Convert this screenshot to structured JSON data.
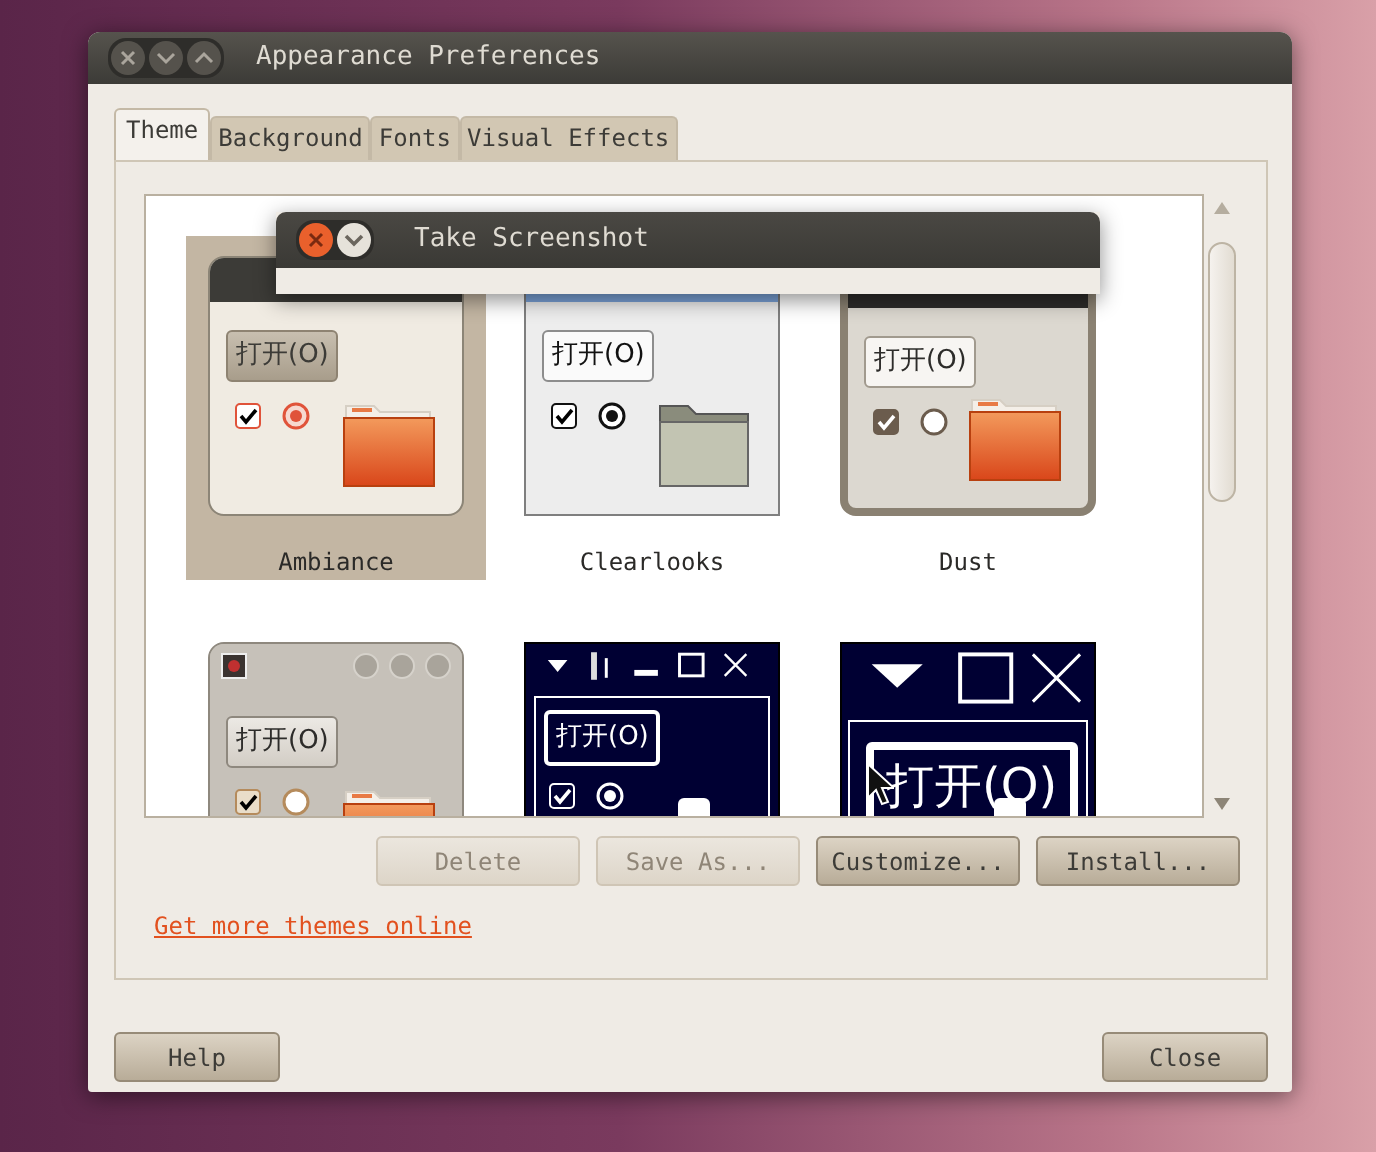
{
  "window": {
    "title": "Appearance Preferences"
  },
  "tabs": [
    {
      "label": "Theme",
      "selected": true
    },
    {
      "label": "Background",
      "selected": false
    },
    {
      "label": "Fonts",
      "selected": false
    },
    {
      "label": "Visual Effects",
      "selected": false
    }
  ],
  "themes": [
    {
      "name": "Ambiance",
      "kind": "ambiance",
      "selected": true,
      "button_label": "打开(O)"
    },
    {
      "name": "Clearlooks",
      "kind": "clearlooks",
      "selected": false,
      "button_label": "打开(O)"
    },
    {
      "name": "Dust",
      "kind": "dust",
      "selected": false,
      "button_label": "打开(O)"
    },
    {
      "kind": "sand",
      "selected": false,
      "button_label": "打开(O)"
    },
    {
      "kind": "contrast",
      "selected": false,
      "button_label": "打开(O)"
    },
    {
      "kind": "contrast-large",
      "selected": false,
      "button_label": "打开(O)"
    }
  ],
  "actions": [
    {
      "label": "Delete",
      "disabled": true
    },
    {
      "label": "Save As...",
      "disabled": true
    },
    {
      "label": "Customize...",
      "disabled": false
    },
    {
      "label": "Install...",
      "disabled": false
    }
  ],
  "link": "Get more themes online",
  "footer_buttons": [
    "Help",
    "Close"
  ],
  "overlay_window": {
    "title": "Take Screenshot"
  }
}
